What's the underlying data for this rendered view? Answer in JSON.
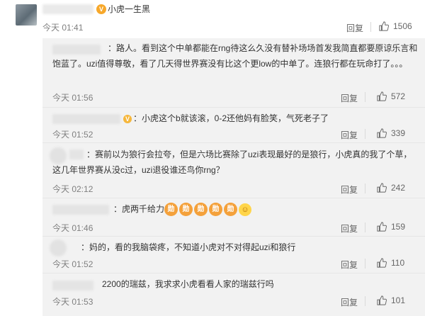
{
  "main_comment": {
    "text": "小虎一生黑",
    "time": "今天 01:41",
    "reply_label": "回复",
    "likes": "1506",
    "badge_icon": "weibo-vip-badge"
  },
  "replies": [
    {
      "text": "：路人。看到这个中单都能在rng待这么久没有替补场场首发我简直都要原谅乐言和饱蓝了。uzi值得尊敬，看了几天得世界赛没有比这个更low的中单了。连狼行都在玩命打了。。。",
      "time": "今天 01:56",
      "reply_label": "回复",
      "likes": "572"
    },
    {
      "text": "：小虎这个b就该滚，0-2还他妈有脸笑，气死老子了",
      "time": "今天 01:52",
      "reply_label": "回复",
      "likes": "339",
      "vip_icon": "vip-badge"
    },
    {
      "text": "：赛前以为狼行会拉夸，但是六场比赛除了uzi表现最好的是狼行，小虎真的我了个草，这几年世界赛从没c过，uzi退役谁还鸟你rng？",
      "time": "今天 02:12",
      "reply_label": "回复",
      "likes": "242"
    },
    {
      "text": "：虎两千给力",
      "time": "今天 01:46",
      "reply_label": "回复",
      "likes": "159",
      "emoji_label": "勋",
      "emoji_count": 5
    },
    {
      "text": "：妈的，看的我脑袋疼，不知道小虎对不对得起uzi和狼行",
      "time": "今天 01:52",
      "reply_label": "回复",
      "likes": "110"
    },
    {
      "text": "2200的瑞兹，我求求小虎看看人家的瑞兹行吗",
      "time": "今天 01:53",
      "reply_label": "回复",
      "likes": "101"
    }
  ],
  "colors": {
    "background": "#ffffff",
    "reply_background": "#f2f2f2",
    "timestamp": "#808080",
    "text": "#333333"
  }
}
